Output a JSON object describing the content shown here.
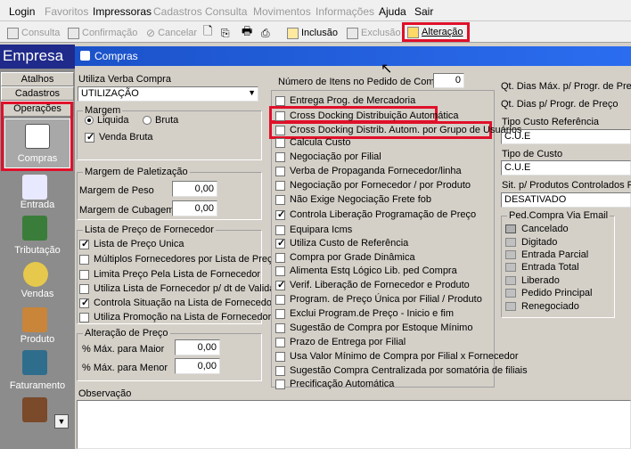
{
  "menu": [
    "Login",
    "Favoritos",
    "Impressoras",
    "Cadastros",
    "Consulta",
    "Movimentos",
    "Informações",
    "Ajuda",
    "Sair"
  ],
  "toolbar": {
    "consulta": "Consulta",
    "confirmacao": "Confirmação",
    "cancelar": "Cancelar",
    "inclusao": "Inclusão",
    "exclusao": "Exclusão",
    "alteracao": "Alteração"
  },
  "sidebar": {
    "title": "Empresa",
    "tabs": [
      "Atalhos",
      "Cadastros",
      "Operações"
    ],
    "items": [
      "Compras",
      "Entrada",
      "Tributação",
      "Vendas",
      "Produto",
      "Faturamento"
    ]
  },
  "panel_title": "Compras",
  "utiliza_verba": {
    "label": "Utiliza Verba Compra",
    "value": "UTILIZAÇÃO"
  },
  "margem": {
    "title": "Margem",
    "liquida": "Liquida",
    "bruta": "Bruta",
    "venda_bruta": "Venda Bruta"
  },
  "paletizacao": {
    "title": "Margem de Paletização",
    "peso_label": "Margem de Peso",
    "peso": "0,00",
    "cubagem_label": "Margem de Cubagem",
    "cubagem": "0,00"
  },
  "lista_preco": {
    "title": "Lista de Preço de Fornecedor",
    "items": [
      "Lista de Preço Unica",
      "Múltiplos Fornecedores por Lista de Preço",
      "Limita Preço Pela Lista de Fornecedor",
      "Utiliza Lista de Fornecedor p/ dt de Validade",
      "Controla Situação na Lista de Fornecedor",
      "Utiliza Promoção na Lista de Fornecedor"
    ]
  },
  "alteracao_preco": {
    "title": "Alteração de Preço",
    "maior_label": "% Máx. para Maior",
    "maior": "0,00",
    "menor_label": "% Máx. para Menor",
    "menor": "0,00"
  },
  "observacao": "Observação",
  "num_itens": {
    "label": "Número de Itens no Pedido de Compra",
    "value": "0"
  },
  "options": [
    "Entrega Prog. de Mercadoria",
    "Cross Docking Distribuição Automática",
    "Cross Docking Distrib. Autom. por Grupo de Usuários",
    "Calcula Custo",
    "Negociação por Filial",
    "Verba de Propaganda Fornecedor/linha",
    "Negociação por Fornecedor / por Produto",
    "Não Exige Negociação Frete fob",
    "Controla Liberação Programação de Preço",
    "Equipara Icms",
    "Utiliza Custo de Referência",
    "Compra por Grade Dinâmica",
    "Alimenta Estq Lógico Lib. ped Compra",
    "Verif. Liberação de Fornecedor e Produto",
    "Program. de Preço Única por Filial / Produto",
    "Exclui Program.de Preço - Inicio e fim",
    "Sugestão de Compra por Estoque Mínimo",
    "Prazo de Entrega por Filial",
    "Usa Valor Mínimo de Compra por Filial x Fornecedor",
    "Sugestão Compra Centralizada por somatória de filiais",
    "Precificação Automática"
  ],
  "right": {
    "qt_max": "Qt. Dias Máx. p/ Progr. de Preço",
    "qt_dias": "Qt. Dias p/ Progr. de Preço",
    "tipo_custo_ref_label": "Tipo Custo Referência",
    "tipo_custo_ref": "C.U.E",
    "tipo_custo_label": "Tipo de Custo",
    "tipo_custo": "C.U.E",
    "sit_label": "Sit. p/ Produtos Controlados Fora",
    "sit": "DESATIVADO",
    "email_title": "Ped.Compra Via Email",
    "email_items": [
      "Cancelado",
      "Digitado",
      "Entrada Parcial",
      "Entrada Total",
      "Liberado",
      "Pedido Principal",
      "Renegociado"
    ]
  }
}
